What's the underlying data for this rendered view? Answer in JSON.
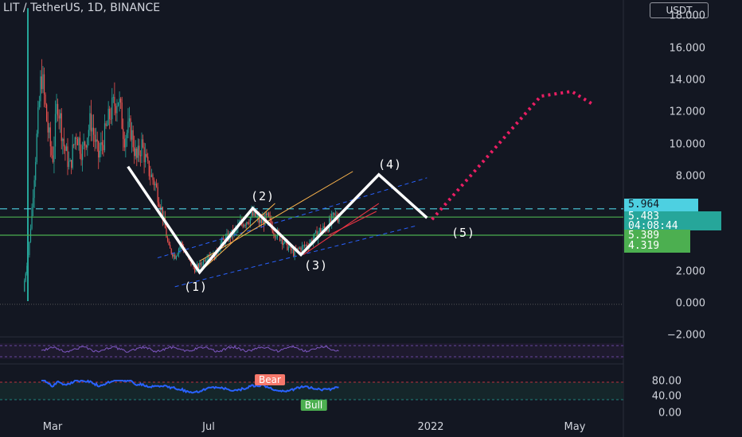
{
  "header": {
    "title": "LIT / TetherUS, 1D, BINANCE",
    "currency_button": "USDT"
  },
  "colors": {
    "background": "#131722",
    "up": "#26a69a",
    "down": "#ef5350",
    "accent_cyan": "#4dd0e1",
    "teal_badge": "#26a69a",
    "green_badge": "#4caf50",
    "pattern_white": "#ffffff",
    "projection_red": "#e91e63",
    "rsi_blue": "#2962ff",
    "stoch_purple": "#7e57c2"
  },
  "waves": {
    "labels": [
      "(1)",
      "(2)",
      "(3)",
      "(4)",
      "(5)"
    ]
  },
  "price_badges": {
    "cyan": "5.964",
    "teal_price": "5.483",
    "teal_timer": "04:08:44",
    "green_upper": "5.389",
    "green_lower": "4.319"
  },
  "indicator_tags": {
    "bear": "Bear",
    "bull": "Bull"
  },
  "chart_data": {
    "type": "candlestick",
    "title": "LIT / TetherUS, 1D, BINANCE",
    "y_axis": {
      "range": [
        -2.0,
        18.0
      ],
      "ticks": [
        "18.000",
        "16.000",
        "14.000",
        "12.000",
        "10.000",
        "8.000",
        "2.000",
        "0.000",
        "−2.000"
      ]
    },
    "x_axis": {
      "ticks": [
        "Mar",
        "Jul",
        "2022",
        "May"
      ]
    },
    "oscillator_axis": {
      "ticks": [
        "80.00",
        "40.00",
        "0.00"
      ]
    },
    "price_path": [
      [
        "2021-02-05",
        0.8
      ],
      [
        "2021-02-10",
        3.5
      ],
      [
        "2021-02-15",
        9.0
      ],
      [
        "2021-02-20",
        14.5
      ],
      [
        "2021-02-25",
        11.0
      ],
      [
        "2021-03-01",
        9.0
      ],
      [
        "2021-03-05",
        12.8
      ],
      [
        "2021-03-10",
        10.0
      ],
      [
        "2021-03-15",
        8.5
      ],
      [
        "2021-03-20",
        10.8
      ],
      [
        "2021-03-25",
        9.5
      ],
      [
        "2021-04-01",
        11.5
      ],
      [
        "2021-04-07",
        9.2
      ],
      [
        "2021-04-12",
        10.5
      ],
      [
        "2021-04-17",
        12.0
      ],
      [
        "2021-04-23",
        13.0
      ],
      [
        "2021-04-28",
        10.5
      ],
      [
        "2021-05-03",
        11.0
      ],
      [
        "2021-05-08",
        9.0
      ],
      [
        "2021-05-12",
        10.0
      ],
      [
        "2021-05-17",
        8.5
      ],
      [
        "2021-05-23",
        7.5
      ],
      [
        "2021-05-28",
        6.0
      ],
      [
        "2021-06-03",
        3.5
      ],
      [
        "2021-06-08",
        3.0
      ],
      [
        "2021-06-13",
        3.8
      ],
      [
        "2021-06-19",
        2.8
      ],
      [
        "2021-06-24",
        2.2
      ],
      [
        "2021-06-29",
        2.5
      ],
      [
        "2021-07-05",
        3.2
      ],
      [
        "2021-07-10",
        3.0
      ],
      [
        "2021-07-15",
        3.8
      ],
      [
        "2021-07-21",
        4.2
      ],
      [
        "2021-07-26",
        4.5
      ],
      [
        "2021-07-31",
        5.0
      ],
      [
        "2021-08-06",
        5.3
      ],
      [
        "2021-08-11",
        5.6
      ],
      [
        "2021-08-16",
        5.1
      ],
      [
        "2021-08-22",
        5.4
      ],
      [
        "2021-08-27",
        4.6
      ],
      [
        "2021-09-01",
        4.2
      ],
      [
        "2021-09-07",
        3.6
      ],
      [
        "2021-09-12",
        3.2
      ],
      [
        "2021-09-17",
        3.5
      ],
      [
        "2021-09-23",
        3.7
      ],
      [
        "2021-09-28",
        4.1
      ],
      [
        "2021-10-03",
        4.6
      ],
      [
        "2021-10-09",
        4.8
      ],
      [
        "2021-10-14",
        5.4
      ],
      [
        "2021-10-19",
        5.5
      ]
    ],
    "elliott_wave_projection": [
      {
        "label": "start",
        "date": "2021-05-01",
        "value": 8.6
      },
      {
        "label": "(1)",
        "date": "2021-06-28",
        "value": 2.0
      },
      {
        "label": "(2)",
        "date": "2021-08-10",
        "value": 6.0
      },
      {
        "label": "(3)",
        "date": "2021-09-18",
        "value": 3.1
      },
      {
        "label": "(4)",
        "date": "2021-11-20",
        "value": 8.1
      },
      {
        "label": "(5)",
        "date": "2021-12-29",
        "value": 5.4
      }
    ],
    "dotted_projection": [
      {
        "date": "2022-01-02",
        "value": 5.3
      },
      {
        "date": "2022-03-31",
        "value": 13.0
      },
      {
        "date": "2022-04-25",
        "value": 13.3
      },
      {
        "date": "2022-05-12",
        "value": 12.5
      }
    ],
    "horizontal_levels": [
      {
        "value": 5.964,
        "style": "dashed",
        "color": "#4dd0e1"
      },
      {
        "value": 5.45,
        "style": "solid",
        "color": "#4caf50"
      },
      {
        "value": 4.319,
        "style": "solid",
        "color": "#4caf50"
      }
    ],
    "grid": false,
    "legend": "none"
  }
}
